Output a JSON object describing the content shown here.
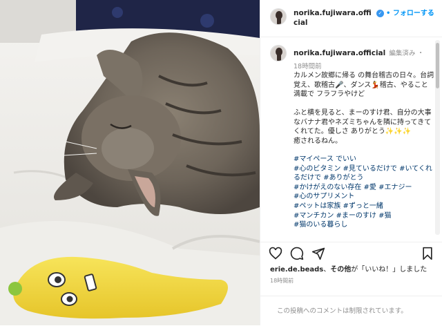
{
  "header": {
    "username": "norika.fujiwara.official",
    "follow_label": "フォローする",
    "separator": "•",
    "more": "•••"
  },
  "caption": {
    "username": "norika.fujiwara.official",
    "meta": "編集済み ・ 18時間前",
    "body": "カルメン故郷に帰る の舞台稽古の日々。台詞覚え、歌稽古🎤、ダンス💃稽古、やること満載で フラフラやけど\n\nふと横を見ると、まーのすけ君、自分の大事なバナナ君やネズミちゃんを隣に持ってきてくれてた。優しさ ありがとう✨✨✨\n癒されるねん。",
    "hashtags": "#マイペース でいい\n#心のビタミン #見ているだけで #いてくれるだけで #ありがとう\n#かけがえのない存在 #愛 #エナジー\n#心のサプリメント\n#ペットは家族 #ずっと一緒\n#マンチカン #まーのすけ #猫\n#猫のいる暮らし"
  },
  "likes": {
    "user": "erie.de.beads",
    "text_mid": "、",
    "others": "その他",
    "text_end": "が「いいね！」しました"
  },
  "time": "18時間前",
  "comments_disabled": "この投稿へのコメントは制限されています。",
  "icons": [
    "heart-icon",
    "comment-icon",
    "share-icon",
    "bookmark-icon",
    "verified-icon"
  ],
  "colors": {
    "link": "#00376b",
    "follow": "#0095f6",
    "verified": "#3897f0",
    "muted": "#8e8e8e"
  }
}
